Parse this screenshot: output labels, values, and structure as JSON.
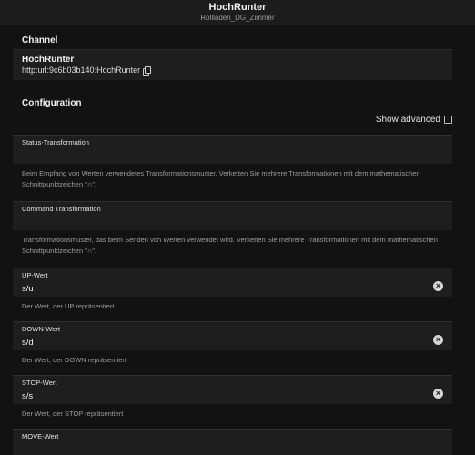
{
  "header": {
    "title": "HochRunter",
    "subtitle": "Rollladen_DG_Zimmer"
  },
  "channel": {
    "section_title": "Channel",
    "name": "HochRunter",
    "uid": "http:url:9c6b03b140:HochRunter"
  },
  "configuration": {
    "section_title": "Configuration",
    "show_advanced_label": "Show advanced",
    "show_advanced_checked": false,
    "fields": [
      {
        "label": "Status-Transformation",
        "value": "",
        "help": "Beim Empfang von Werten verwendetes Transformationsmuster. Verketten Sie mehrere Transformationen mit dem mathematischen Schnittpunktzeichen \"∩\"."
      },
      {
        "label": "Command Transformation",
        "value": "",
        "help": "Transformationsmuster, das beim Senden von Werten verwendet wird. Verketten Sie mehrere Transformationen mit dem mathematischen Schnittpunktzeichen \"∩\"."
      },
      {
        "label": "UP-Wert",
        "value": "s/u",
        "help": "Der Wert, der UP repräsentiert"
      },
      {
        "label": "DOWN-Wert",
        "value": "s/d",
        "help": "Der Wert, der DOWN repräsentiert"
      },
      {
        "label": "STOP-Wert",
        "value": "s/s",
        "help": "Der Wert, der STOP repräsentiert"
      },
      {
        "label": "MOVE-Wert",
        "value": "",
        "help": ""
      }
    ]
  },
  "icons": {
    "copy": "copy-icon",
    "clear": "clear-icon"
  }
}
